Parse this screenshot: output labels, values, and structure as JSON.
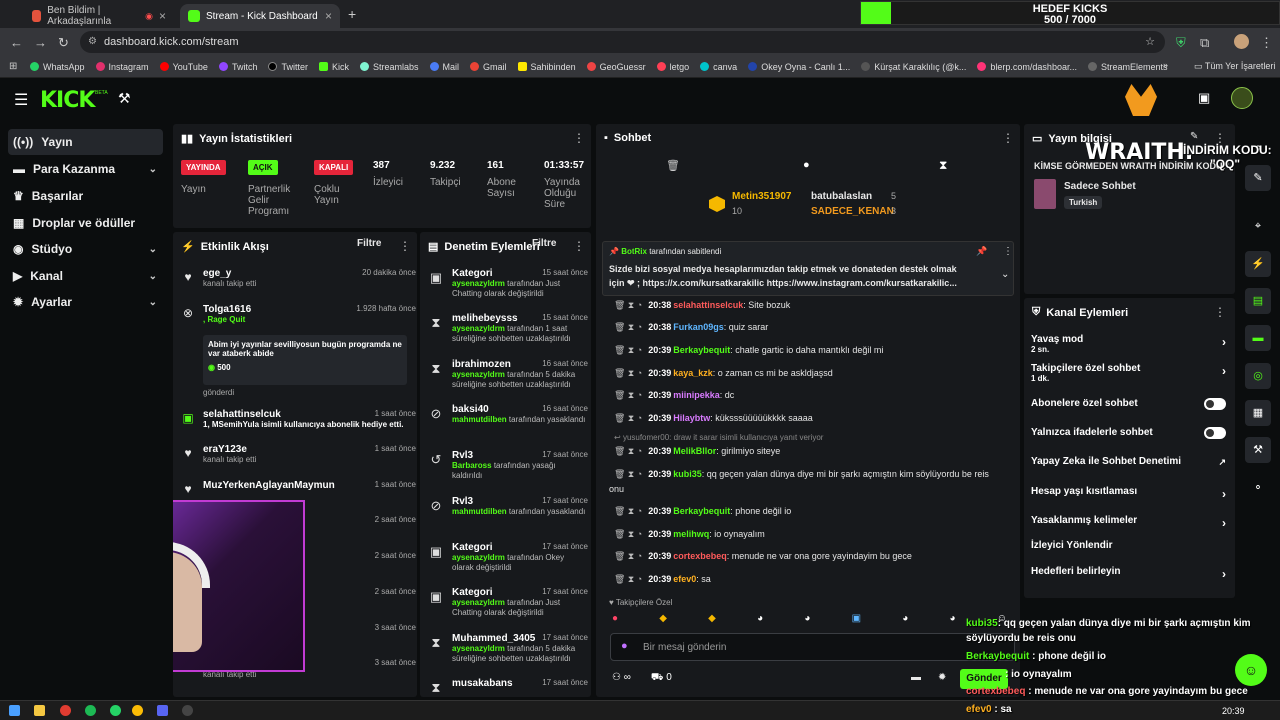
{
  "browser": {
    "tabs": [
      {
        "title": "Ben Bildim | Arkadaşlarınla"
      },
      {
        "title": "Stream - Kick Dashboard"
      }
    ],
    "new_tab": "+",
    "url": "dashboard.kick.com/stream",
    "bookmarks": [
      "WhatsApp",
      "Instagram",
      "YouTube",
      "Twitch",
      "Twitter",
      "Kick",
      "Streamlabs",
      "Mail",
      "Gmail",
      "Sahibinden",
      "GeoGuessr",
      "letgo",
      "canva",
      "Okey Oyna - Canlı 1...",
      "Kürşat Karaklılıç (@k...",
      "blerp.com/dashboar...",
      "StreamElements"
    ],
    "all_bookmarks": "Tüm Yer İşaretleri"
  },
  "goal": {
    "title": "HEDEF KICKS",
    "value": "500 / 7000",
    "progress": 0.0714
  },
  "app": {
    "logo": "KICK",
    "beta": "BETA"
  },
  "sidebar": {
    "items": [
      {
        "label": "Yayın",
        "icon": "broadcast-icon"
      },
      {
        "label": "Para Kazanma",
        "icon": "money-icon"
      },
      {
        "label": "Başarılar",
        "icon": "trophy-icon"
      },
      {
        "label": "Droplar ve ödüller",
        "icon": "gift-icon"
      },
      {
        "label": "Stüdyo",
        "icon": "studio-icon"
      },
      {
        "label": "Kanal",
        "icon": "channel-icon"
      },
      {
        "label": "Ayarlar",
        "icon": "gear-icon"
      }
    ]
  },
  "stats": {
    "title": "Yayın İstatistikleri",
    "live_badge": "YAYINDA",
    "live_label": "Yayın",
    "partner_badge": "AÇIK",
    "partner_label": "Partnerlik Gelir Programı",
    "multi_badge": "KAPALI",
    "multi_label": "Çoklu Yayın",
    "viewers": "387",
    "viewers_label": "İzleyici",
    "followers": "9.232",
    "followers_label": "Takipçi",
    "subs": "161",
    "subs_label": "Abone Sayısı",
    "duration": "01:33:57",
    "duration_label": "Yayında Olduğu Süre"
  },
  "activity": {
    "title": "Etkinlik Akışı",
    "filter": "Filtre",
    "items": [
      {
        "name": "ege_y",
        "sub": "kanalı takip etti",
        "time": "20 dakika önce"
      },
      {
        "name": "Tolga1616",
        "sub": ", Rage Quit",
        "time": "1.928 hafta önce"
      },
      {
        "message": "Abim iyi yayınlar sevilliyosun bugün programda ne var ataberk abide",
        "amount": "500",
        "sent": "gönderdi"
      },
      {
        "name": "selahattinselcuk",
        "sub": "1, MSemihYula isimli kullanıcıya abonelik hediye etti.",
        "time": "1 saat önce"
      },
      {
        "name": "eraY123e",
        "sub": "kanalı takip etti",
        "time": "1 saat önce"
      },
      {
        "name": "MuzYerkenAglayanMaymun",
        "sub": "",
        "time": "1 saat önce"
      },
      {
        "time": "2 saat önce"
      },
      {
        "time": "2 saat önce"
      },
      {
        "time": "2 saat önce"
      },
      {
        "time": "3 saat önce"
      },
      {
        "time": "3 saat önce",
        "sub": "kanalı takip etti"
      }
    ]
  },
  "moderation": {
    "title": "Denetim Eylemleri",
    "filter": "Filtre",
    "items": [
      {
        "name": "Kategori",
        "time": "15 saat önce",
        "actor": "aysenazyldrm",
        "text": "tarafından Just Chatting olarak değiştirildi"
      },
      {
        "name": "melihebeysss",
        "time": "15 saat önce",
        "actor": "aysenazyldrm",
        "text": "tarafından 1 saat süreliğine sohbetten uzaklaştırıldı"
      },
      {
        "name": "ibrahimozen",
        "time": "16 saat önce",
        "actor": "aysenazyldrm",
        "text": "tarafından 5 dakika süreliğine sohbetten uzaklaştırıldı"
      },
      {
        "name": "baksi40",
        "time": "16 saat önce",
        "actor": "mahmutdilben",
        "text": "tarafından yasaklandı"
      },
      {
        "name": "Rvl3",
        "time": "17 saat önce",
        "actor": "Barbaross",
        "text": "tarafından yasağı kaldırıldı"
      },
      {
        "name": "Rvl3",
        "time": "17 saat önce",
        "actor": "mahmutdilben",
        "text": "tarafından yasaklandı"
      },
      {
        "name": "Kategori",
        "time": "17 saat önce",
        "actor": "aysenazyldrm",
        "text": "tarafından Okey olarak değiştirildi"
      },
      {
        "name": "Kategori",
        "time": "17 saat önce",
        "actor": "aysenazyldrm",
        "text": "tarafından Just Chatting olarak değiştirildi"
      },
      {
        "name": "Muhammed_3405",
        "time": "17 saat önce",
        "actor": "aysenazyldrm",
        "text": "tarafından 5 dakika süreliğine sohbetten uzaklaştırıldı"
      },
      {
        "name": "musakabans",
        "time": "17 saat önce"
      }
    ]
  },
  "chat": {
    "title": "Sohbet",
    "top1": {
      "name": "Metin351907",
      "value": "10"
    },
    "top2": [
      {
        "name": "batubalaslan",
        "value": "5"
      },
      {
        "name": "SADECE_KENAN",
        "value": "3"
      }
    ],
    "pinned_by": "BotRix",
    "pinned_suffix": "tarafından sabitlendi",
    "pinned_text1": "Sizde bizi sosyal medya hesaplarımızdan takip etmek ve donateden destek olmak",
    "pinned_text2": "için ❤ ; https://x.com/kursatkarakilic https://www.instagram.com/kursatkarakilic...",
    "reply_note": "yusufomer00: draw it sarar isimli kullanıcıya yanıt veriyor",
    "messages": [
      {
        "time": "20:38",
        "user": "selahattinselcuk",
        "color": "#ff5b5b",
        "text": ": Site bozuk"
      },
      {
        "time": "20:38",
        "user": "Furkan09gs",
        "color": "#5fb6ff",
        "text": ": quiz sarar"
      },
      {
        "time": "20:39",
        "user": "Berkaybequit",
        "color": "#53fc18",
        "text": ": chatle gartic io daha mantıklı değil mi"
      },
      {
        "time": "20:39",
        "user": "kaya_kzk",
        "color": "#ffb020",
        "text": ": o zaman cs mi be askldjaşsd"
      },
      {
        "time": "20:39",
        "user": "miinipekka",
        "color": "#d97bff",
        "text": ": dc"
      },
      {
        "time": "20:39",
        "user": "Hilaybtw",
        "color": "#d97bff",
        "text": ": küksssüüüüükkkk saaaa"
      },
      {
        "time": "20:39",
        "user": "MelikBllor",
        "color": "#53fc18",
        "text": ": girilmiyo siteye"
      },
      {
        "time": "20:39",
        "user": "kubi35",
        "color": "#53fc18",
        "text": ": qq geçen yalan dünya diye mi bir şarkı açmıştın kim söylüyordu be reis"
      },
      {
        "time": "20:39",
        "user": "Berkaybequit",
        "color": "#53fc18",
        "text": ": phone değil io"
      },
      {
        "time": "20:39",
        "user": "melihwq",
        "color": "#53fc18",
        "text": ": io oynayalım"
      },
      {
        "time": "20:39",
        "user": "cortexbebeq",
        "color": "#ff5b5b",
        "text": ": menude ne var ona gore yayindayim bu gece"
      },
      {
        "time": "20:39",
        "user": "efev0",
        "color": "#ffb020",
        "text": ": sa"
      }
    ],
    "msg_wrap": "onu",
    "followers_only": "Takipçilere Özel",
    "input_placeholder": "Bir mesaj gönderin",
    "send": "Gönder",
    "viewer_count": "∞",
    "count2": "0"
  },
  "stream_info": {
    "title": "Yayın bilgisi",
    "stream_title": "KİMSE GÖRMEDEN WRAITH İNDİRİM KODU: \"QQ\"",
    "category": "Sadece Sohbet",
    "tag": "Turkish"
  },
  "channel_actions": {
    "title": "Kanal Eylemleri",
    "items": [
      {
        "label": "Yavaş mod",
        "sub": "2 sn.",
        "kind": "chev"
      },
      {
        "label": "Takipçilere özel sohbet",
        "sub": "1 dk.",
        "kind": "chev"
      },
      {
        "label": "Abonelere özel sohbet",
        "kind": "toggle"
      },
      {
        "label": "Yalnızca ifadelerle sohbet",
        "kind": "toggle"
      },
      {
        "label": "Yapay Zeka ile Sohbet Denetimi",
        "kind": "link"
      },
      {
        "label": "Hesap yaşı kısıtlaması",
        "kind": "chev"
      },
      {
        "label": "Yasaklanmış kelimeler",
        "kind": "chev"
      },
      {
        "label": "İzleyici Yönlendir",
        "kind": "none"
      },
      {
        "label": "Hedefleri belirleyin",
        "kind": "chev"
      }
    ]
  },
  "overlay": {
    "brand": "WRAITH.",
    "code_label": "İNDİRİM KODU:",
    "code": "\"QQ\"",
    "lines": [
      {
        "user": "kubi35",
        "text": ": qq geçen yalan dünya diye mi bir şarkı açmıştın kim"
      },
      {
        "user": "",
        "text": "söylüyordu be reis onu"
      },
      {
        "user": "Berkaybequit",
        "text": " : phone değil io"
      },
      {
        "user": "",
        "text": " : io oynayalım"
      },
      {
        "user": "cortexbebeq",
        "text": " : menude ne var ona gore yayinday​ım bu gece"
      },
      {
        "user": "efev0",
        "text": " : sa"
      }
    ]
  },
  "clock": "20:39",
  "colors": {
    "accent": "#53fc18",
    "panel": "#17191c",
    "bg": "#0b0d0e",
    "danger": "#e5253a"
  }
}
